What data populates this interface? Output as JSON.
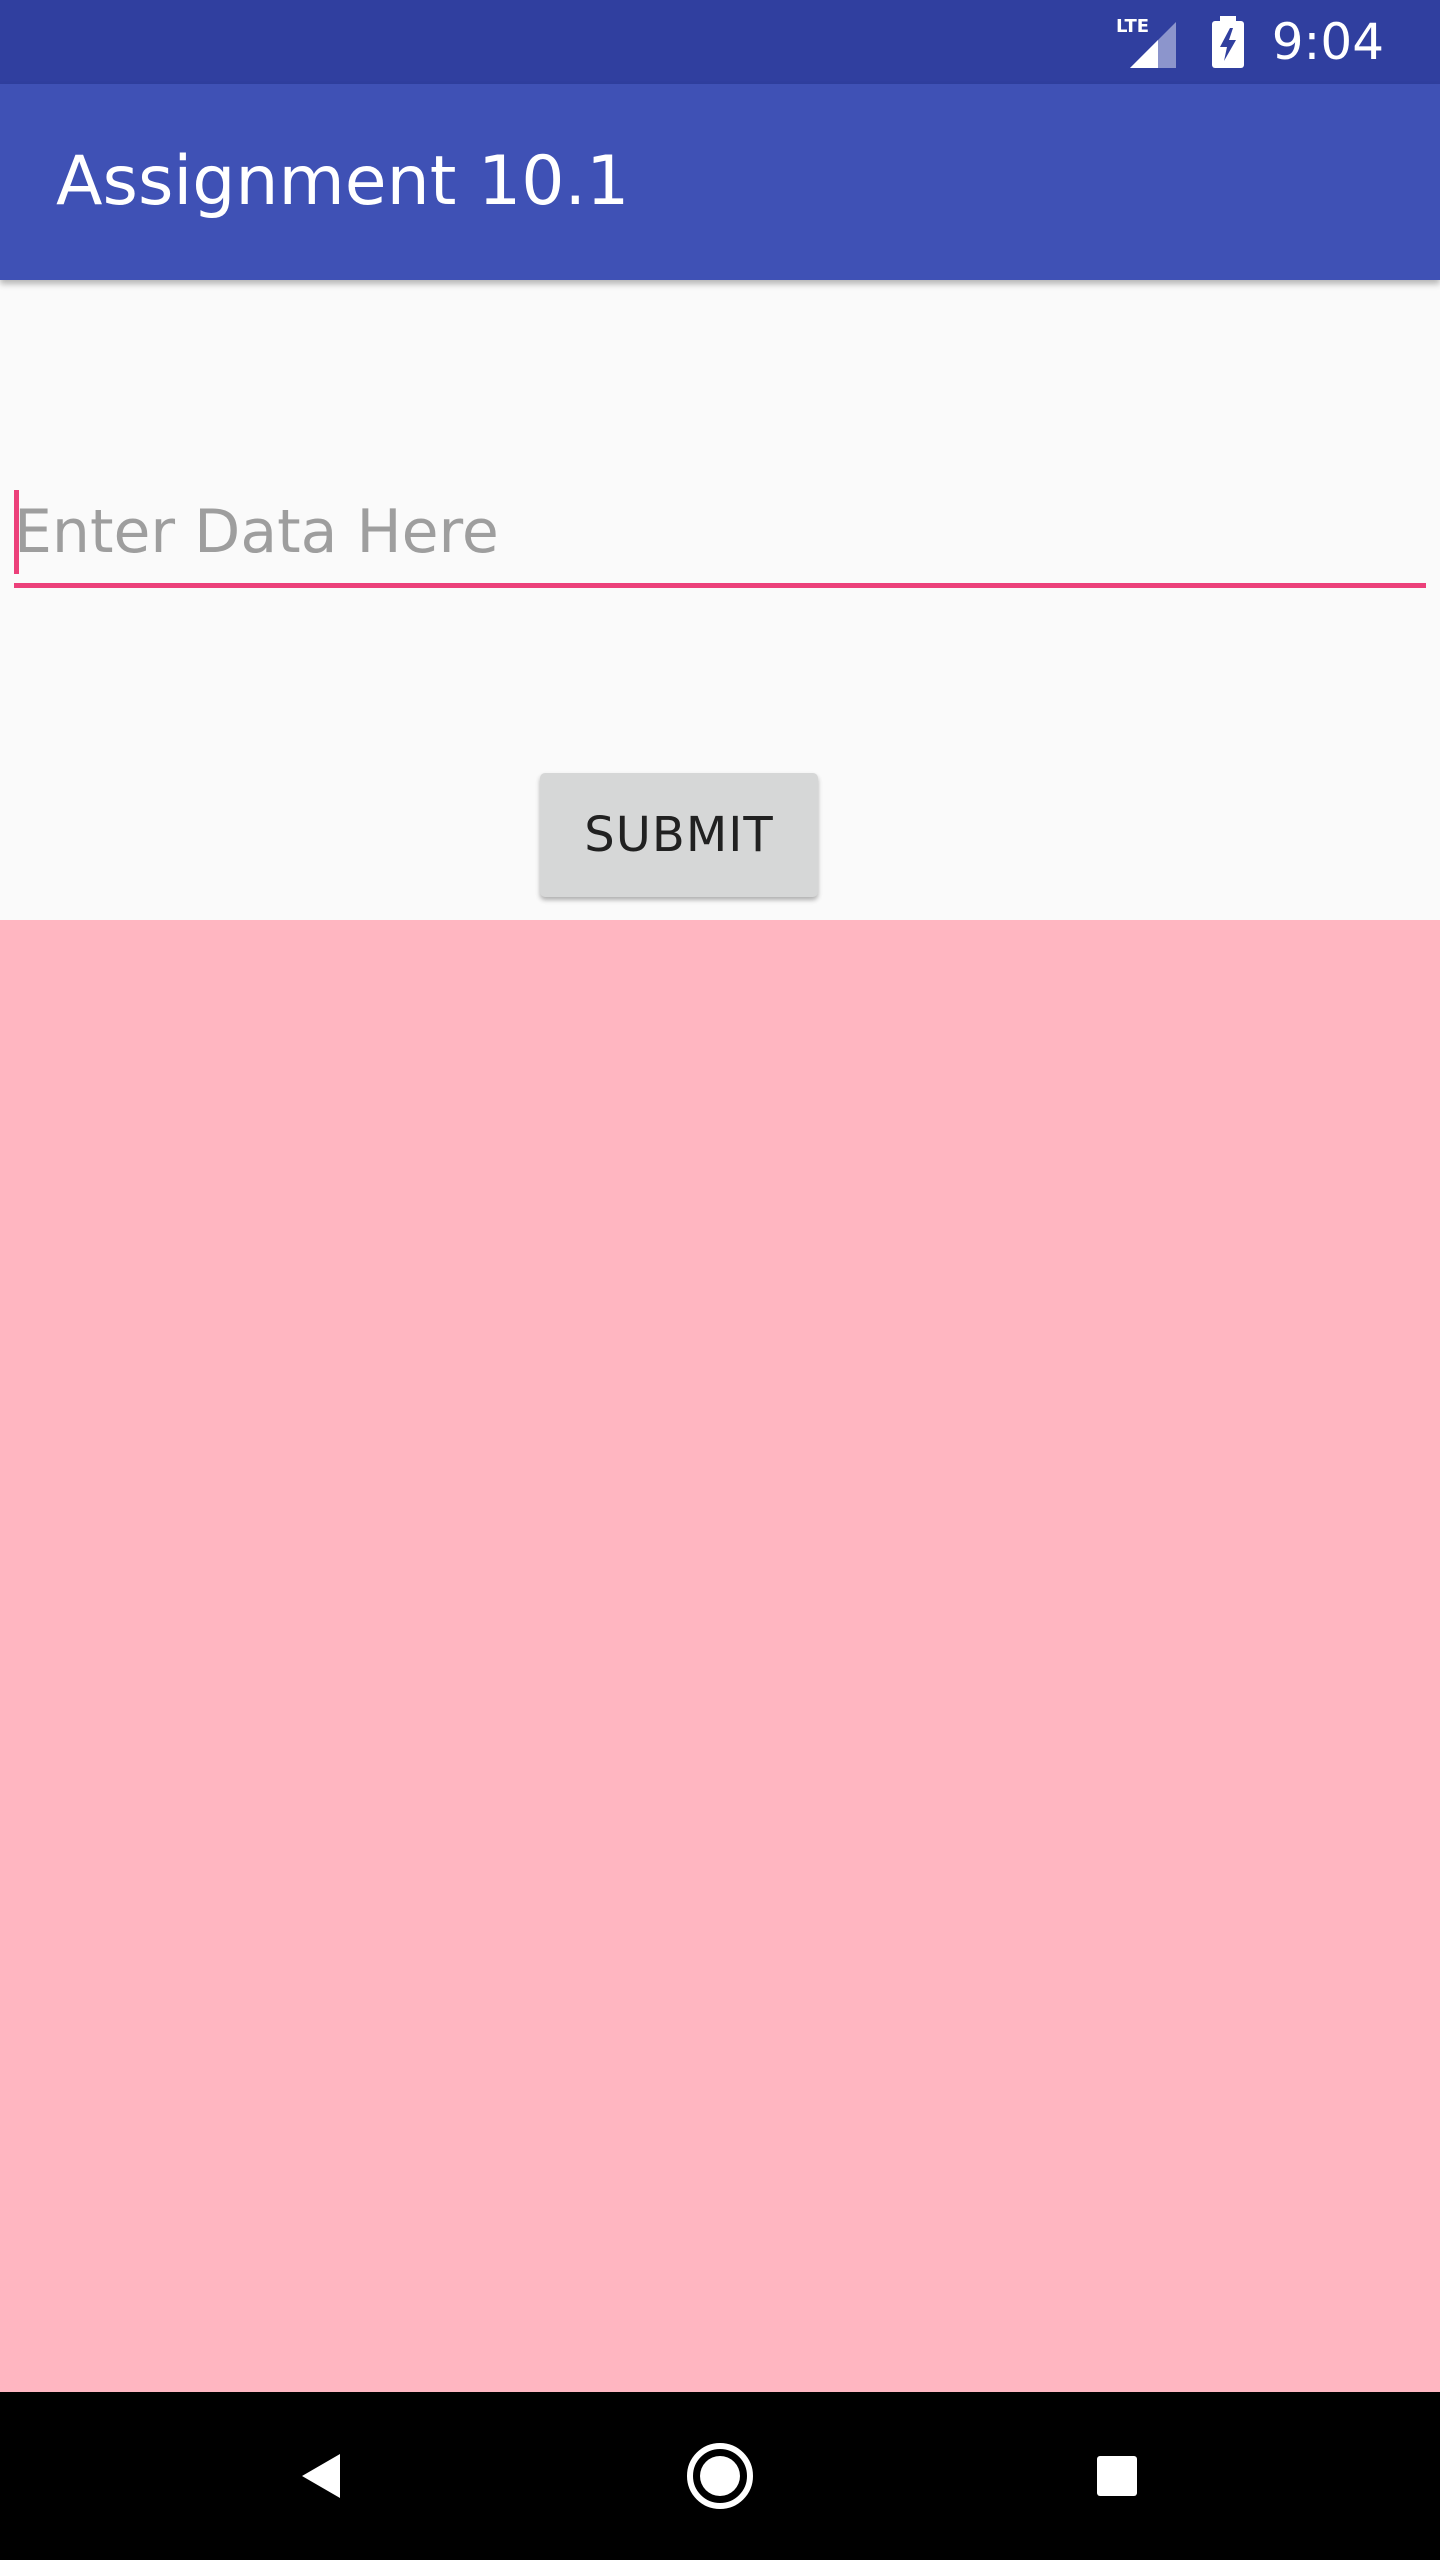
{
  "status_bar": {
    "network_label": "LTE",
    "time": "9:04"
  },
  "app_bar": {
    "title": "Assignment 10.1"
  },
  "form": {
    "input_placeholder": "Enter Data Here",
    "input_value": "",
    "submit_label": "SUBMIT"
  },
  "colors": {
    "status_bar": "#303f9f",
    "app_bar": "#3f51b5",
    "accent": "#ec407a",
    "pink_panel": "#ffb6c1",
    "button": "#d6d7d7"
  },
  "icons": {
    "signal": "lte-signal-icon",
    "battery": "battery-charging-icon",
    "back": "back-icon",
    "home": "home-icon",
    "recents": "recents-icon"
  }
}
